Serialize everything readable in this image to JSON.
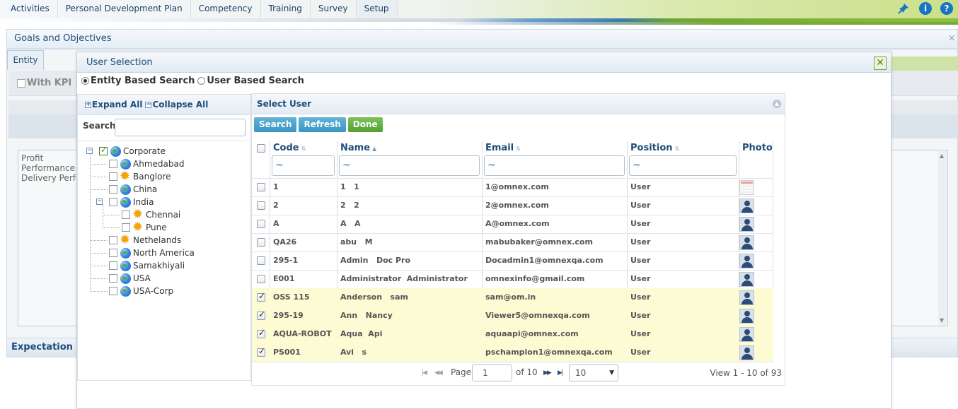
{
  "nav": {
    "items": [
      "Activities",
      "Personal Development Plan",
      "Competency",
      "Training",
      "Survey",
      "Setup"
    ],
    "icons": [
      "pin-icon",
      "info-icon",
      "help-icon"
    ],
    "info_glyph": "i",
    "help_glyph": "?"
  },
  "background": {
    "page_title": "Goals and Objectives",
    "close_glyph": "×",
    "entity_tab": "Entity",
    "with_kpi": "With KPI",
    "textarea_lines": [
      "Profit",
      "Performance",
      "Delivery Perfor"
    ],
    "expectation_label": "Expectation Ca"
  },
  "modal": {
    "title": "User Selection",
    "close_glyph": "✕",
    "search_modes": [
      "Entity Based Search",
      "User Based Search"
    ],
    "selected_mode": "Entity Based Search",
    "tree": {
      "expand_all": "Expand All",
      "collapse_all": "Collapse All",
      "search_label": "Search:",
      "search_value": "",
      "root": {
        "label": "Corporate",
        "checked": true,
        "icon": "globe-icon"
      },
      "nodes": [
        {
          "label": "Ahmedabad",
          "icon": "globe-icon",
          "checked": false
        },
        {
          "label": "Banglore",
          "icon": "sun-icon",
          "checked": false
        },
        {
          "label": "China",
          "icon": "globe-icon",
          "checked": false
        },
        {
          "label": "India",
          "icon": "globe-icon",
          "checked": false
        },
        {
          "label": "Chennai",
          "icon": "sun-icon",
          "checked": false
        },
        {
          "label": "Pune",
          "icon": "sun-icon",
          "checked": false
        },
        {
          "label": "Nethelands",
          "icon": "sun-icon",
          "checked": false
        },
        {
          "label": "North America",
          "icon": "globe-icon",
          "checked": false
        },
        {
          "label": "Samakhiyali",
          "icon": "globe-icon",
          "checked": false
        },
        {
          "label": "USA",
          "icon": "globe-icon",
          "checked": false
        },
        {
          "label": "USA-Corp",
          "icon": "globe-icon",
          "checked": false
        }
      ]
    },
    "grid": {
      "title": "Select User",
      "buttons": {
        "search": "Search",
        "refresh": "Refresh",
        "done": "Done"
      },
      "columns": {
        "code": "Code",
        "name": "Name",
        "email": "Email",
        "position": "Position",
        "photo": "Photo"
      },
      "filter_value": "~",
      "rows": [
        {
          "code": "1",
          "name": "1   1",
          "email": "1@omnex.com",
          "position": "User",
          "checked": false,
          "photo": "blank"
        },
        {
          "code": "2",
          "name": "2   2",
          "email": "2@omnex.com",
          "position": "User",
          "checked": false,
          "photo": "avatar"
        },
        {
          "code": "A",
          "name": "A   A",
          "email": "A@omnex.com",
          "position": "User",
          "checked": false,
          "photo": "avatar"
        },
        {
          "code": "QA26",
          "name": "abu   M",
          "email": "mabubaker@omnex.com",
          "position": "User",
          "checked": false,
          "photo": "avatar"
        },
        {
          "code": "295-1",
          "name": "Admin   Doc Pro",
          "email": "Docadmin1@omnexqa.com",
          "position": "User",
          "checked": false,
          "photo": "avatar"
        },
        {
          "code": "E001",
          "name": "Administrator  Administrator",
          "email": "omnexinfo@gmail.com",
          "position": "User",
          "checked": false,
          "photo": "avatar"
        },
        {
          "code": "OSS 115",
          "name": "Anderson   sam",
          "email": "sam@om.in",
          "position": "User",
          "checked": true,
          "photo": "avatar"
        },
        {
          "code": "295-19",
          "name": "Ann   Nancy",
          "email": "Viewer5@omnexqa.com",
          "position": "User",
          "checked": true,
          "photo": "avatar"
        },
        {
          "code": "AQUA-ROBOT",
          "name": "Aqua  Api",
          "email": "aquaapi@omnex.com",
          "position": "User",
          "checked": true,
          "photo": "avatar"
        },
        {
          "code": "PS001",
          "name": "Avi   s",
          "email": "pschampion1@omnexqa.com",
          "position": "User",
          "checked": true,
          "photo": "avatar"
        }
      ],
      "pager": {
        "page_label": "Page",
        "page_value": "1",
        "of_label": "of 10",
        "page_size": "10",
        "summary": "View 1 - 10 of 93"
      }
    }
  }
}
